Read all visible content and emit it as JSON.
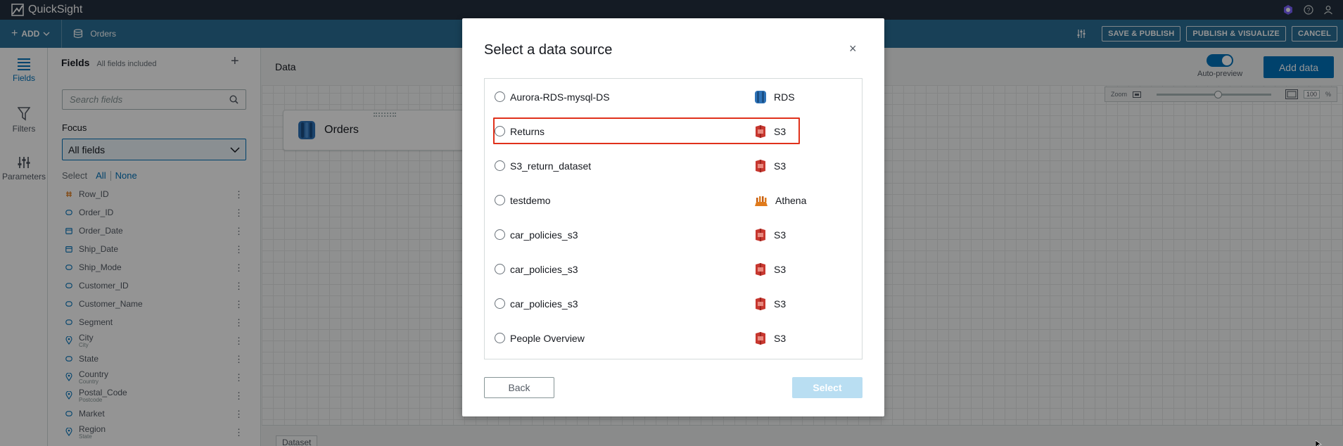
{
  "app": {
    "name": "QuickSight"
  },
  "toolbar": {
    "add_label": "ADD",
    "dataset_name": "Orders",
    "buttons": [
      "SAVE & PUBLISH",
      "PUBLISH & VISUALIZE",
      "CANCEL"
    ]
  },
  "leftnav": {
    "items": [
      "Fields",
      "Filters",
      "Parameters"
    ]
  },
  "fields_panel": {
    "title": "Fields",
    "subtitle": "All fields included",
    "search_placeholder": "Search fields",
    "focus_label": "Focus",
    "focus_value": "All fields",
    "select_label": "Select",
    "select_all": "All",
    "select_none": "None",
    "fields": [
      {
        "name": "Row_ID",
        "sub": "",
        "icon": "hash-icon"
      },
      {
        "name": "Order_ID",
        "sub": "",
        "icon": "text-icon"
      },
      {
        "name": "Order_Date",
        "sub": "",
        "icon": "calendar-icon"
      },
      {
        "name": "Ship_Date",
        "sub": "",
        "icon": "calendar-icon"
      },
      {
        "name": "Ship_Mode",
        "sub": "",
        "icon": "text-icon"
      },
      {
        "name": "Customer_ID",
        "sub": "",
        "icon": "text-icon"
      },
      {
        "name": "Customer_Name",
        "sub": "",
        "icon": "text-icon"
      },
      {
        "name": "Segment",
        "sub": "",
        "icon": "text-icon"
      },
      {
        "name": "City",
        "sub": "City",
        "icon": "geo-icon"
      },
      {
        "name": "State",
        "sub": "",
        "icon": "text-icon"
      },
      {
        "name": "Country",
        "sub": "Country",
        "icon": "geo-icon"
      },
      {
        "name": "Postal_Code",
        "sub": "Postcode",
        "icon": "geo-icon"
      },
      {
        "name": "Market",
        "sub": "",
        "icon": "text-icon"
      },
      {
        "name": "Region",
        "sub": "State",
        "icon": "geo-icon"
      }
    ]
  },
  "canvas": {
    "title": "Data",
    "auto_preview_label": "Auto-preview",
    "add_data_label": "Add data",
    "zoom_label": "Zoom",
    "zoom_value": "100",
    "zoom_unit": "%",
    "node_name": "Orders",
    "dataset_tab": "Dataset"
  },
  "modal": {
    "title": "Select a data source",
    "close": "×",
    "back_label": "Back",
    "select_label": "Select",
    "sources": [
      {
        "name": "Aurora-RDS-mysql-DS",
        "type": "RDS",
        "icon": "rds-icon"
      },
      {
        "name": "Returns",
        "type": "S3",
        "icon": "s3-icon"
      },
      {
        "name": "S3_return_dataset",
        "type": "S3",
        "icon": "s3-icon"
      },
      {
        "name": "testdemo",
        "type": "Athena",
        "icon": "athena-icon"
      },
      {
        "name": "car_policies_s3",
        "type": "S3",
        "icon": "s3-icon"
      },
      {
        "name": "car_policies_s3",
        "type": "S3",
        "icon": "s3-icon"
      },
      {
        "name": "car_policies_s3",
        "type": "S3",
        "icon": "s3-icon"
      },
      {
        "name": "People Overview",
        "type": "S3",
        "icon": "s3-icon"
      }
    ]
  },
  "colors": {
    "topbar": "#232f3e",
    "toolbar": "#2a6f97",
    "accent": "#0073bb",
    "highlight": "#e0311b",
    "s3": "#c7372f",
    "athena": "#e07b1b",
    "rds": "#2e73b8"
  }
}
